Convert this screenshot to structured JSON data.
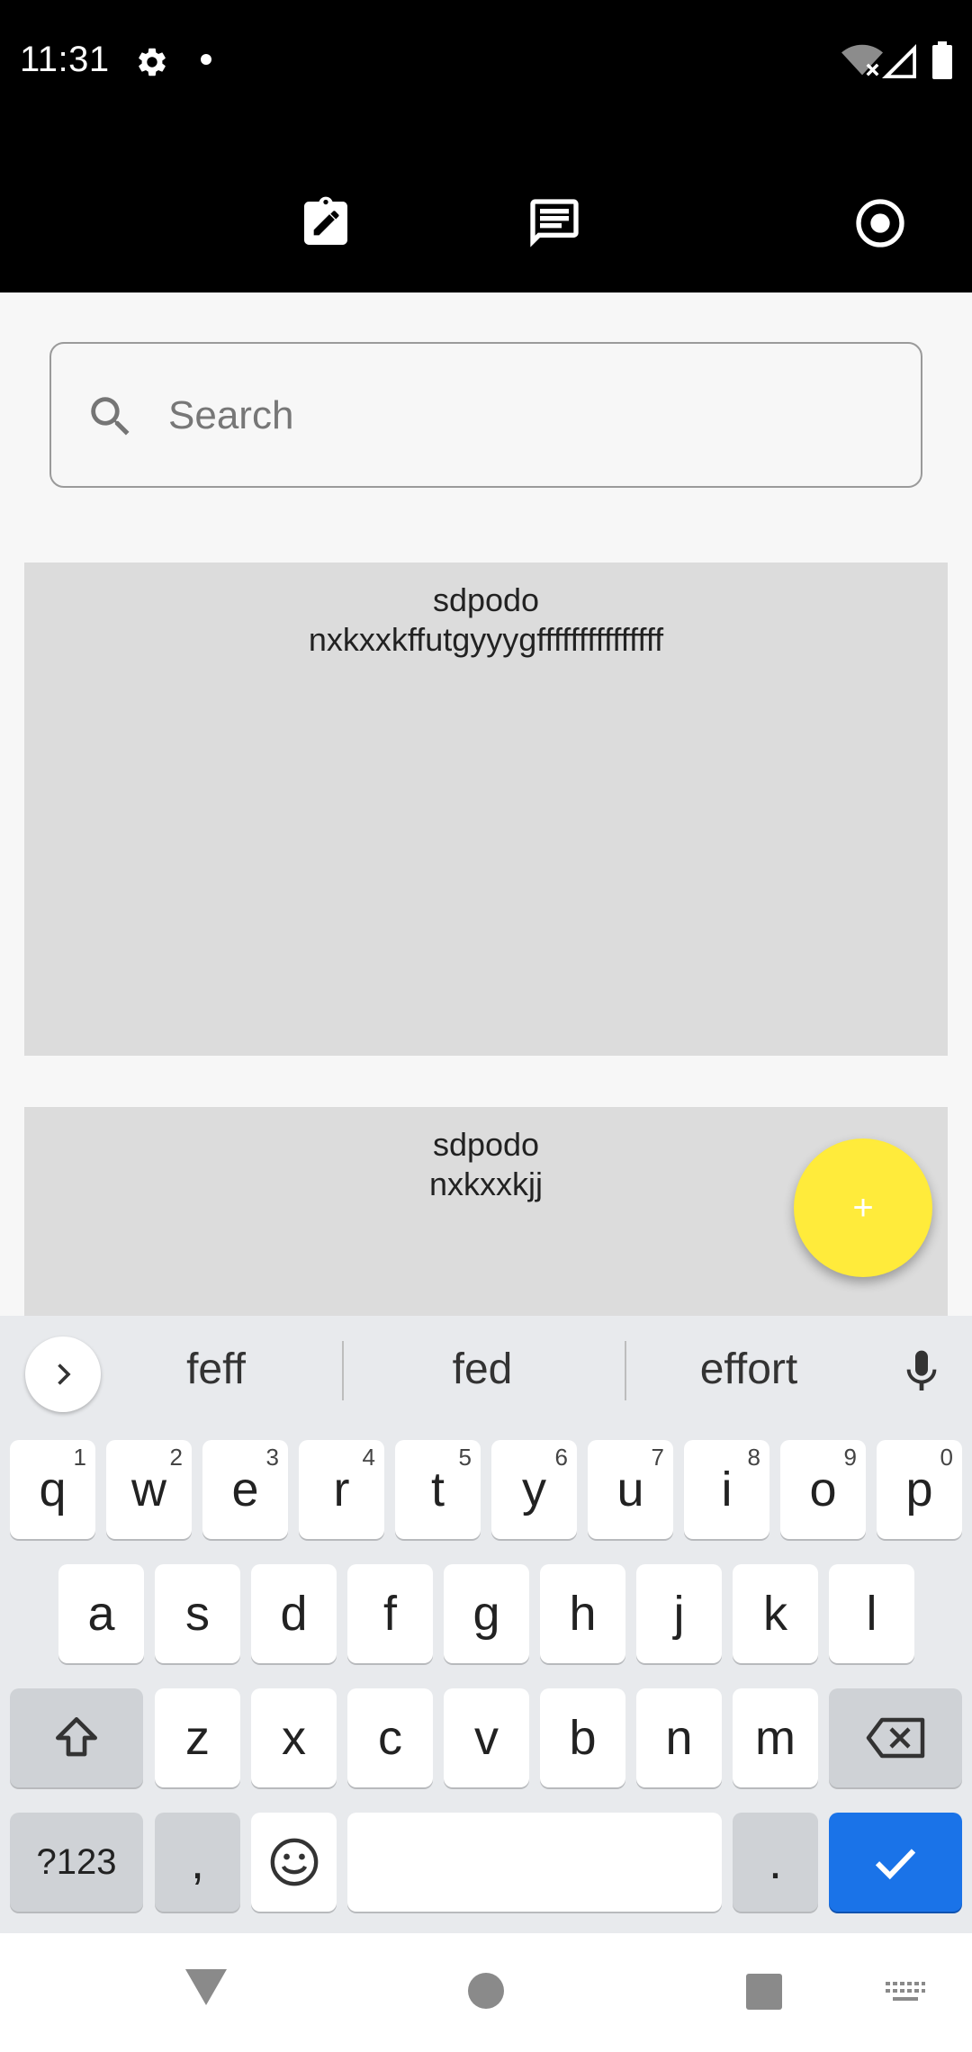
{
  "status_bar": {
    "time": "11:31"
  },
  "search": {
    "placeholder": "Search",
    "value": ""
  },
  "notes": [
    {
      "title": "sdpodo",
      "body": "nxkxxkffutgyyygfffffffffffffff"
    },
    {
      "title": "sdpodo",
      "body": "nxkxxkjj"
    }
  ],
  "fab": {
    "label": "+",
    "color": "#ffeb3b"
  },
  "keyboard": {
    "suggestions": [
      "feff",
      "fed",
      "effort"
    ],
    "row1": [
      {
        "label": "q",
        "hint": "1"
      },
      {
        "label": "w",
        "hint": "2"
      },
      {
        "label": "e",
        "hint": "3"
      },
      {
        "label": "r",
        "hint": "4"
      },
      {
        "label": "t",
        "hint": "5"
      },
      {
        "label": "y",
        "hint": "6"
      },
      {
        "label": "u",
        "hint": "7"
      },
      {
        "label": "i",
        "hint": "8"
      },
      {
        "label": "o",
        "hint": "9"
      },
      {
        "label": "p",
        "hint": "0"
      }
    ],
    "row2": [
      "a",
      "s",
      "d",
      "f",
      "g",
      "h",
      "j",
      "k",
      "l"
    ],
    "row3": [
      "z",
      "x",
      "c",
      "v",
      "b",
      "n",
      "m"
    ],
    "symbols_label": "?123",
    "comma_label": ",",
    "period_label": ".",
    "enter_color": "#1a73e8"
  },
  "icons": {
    "status": [
      "settings-gear-icon",
      "notification-dot-icon",
      "wifi-off-icon",
      "signal-icon",
      "battery-icon"
    ],
    "toolbar": [
      "edit-note-icon",
      "notes-list-icon",
      "record-icon"
    ],
    "nav": [
      "back-icon",
      "home-icon",
      "recents-icon",
      "keyboard-switch-icon"
    ]
  }
}
